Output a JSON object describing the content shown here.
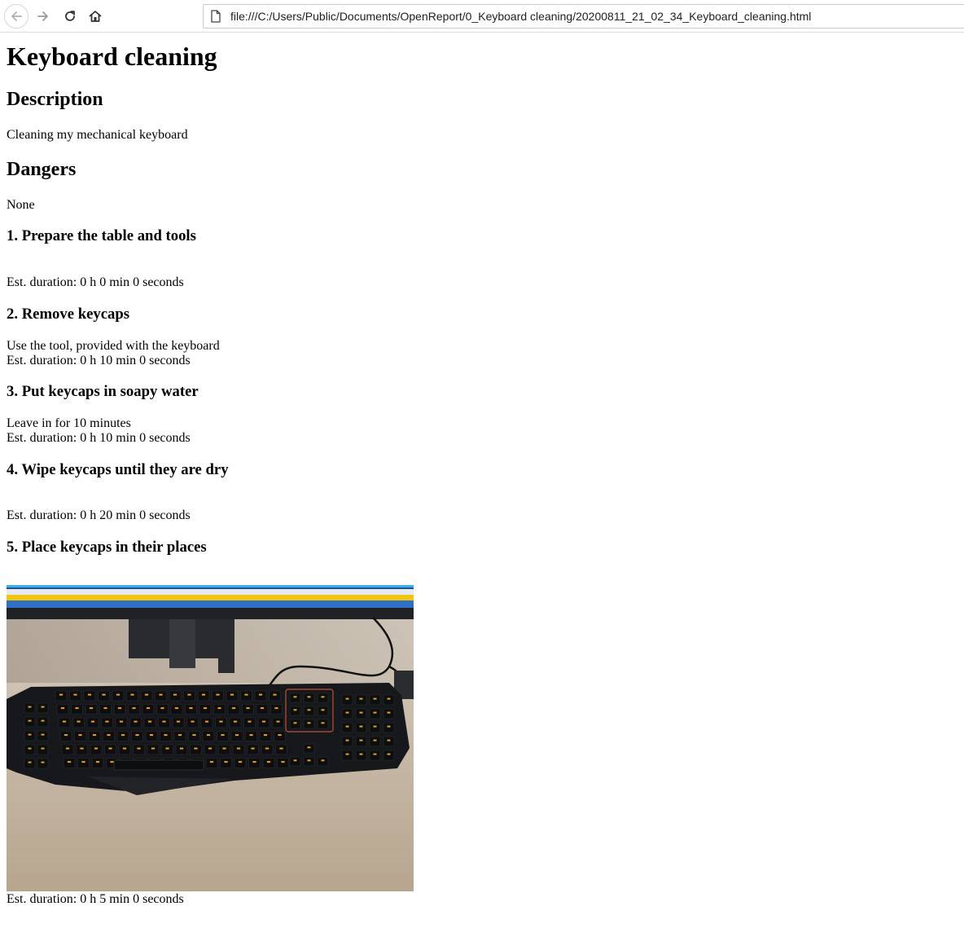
{
  "browser": {
    "url": "file:///C:/Users/Public/Documents/OpenReport/0_Keyboard cleaning/20200811_21_02_34_Keyboard_cleaning.html",
    "icons": [
      "back-arrow-icon",
      "forward-arrow-icon",
      "reload-icon",
      "home-icon",
      "file-icon"
    ]
  },
  "page": {
    "title": "Keyboard cleaning",
    "description_heading": "Description",
    "description": "Cleaning my mechanical keyboard",
    "dangers_heading": "Dangers",
    "dangers": "None"
  },
  "steps": [
    {
      "heading": "1. Prepare the table and tools",
      "note": "",
      "duration": "Est. duration: 0 h 0 min 0 seconds"
    },
    {
      "heading": "2. Remove keycaps",
      "note": "Use the tool, provided with the keyboard",
      "duration": "Est. duration: 0 h 10 min 0 seconds"
    },
    {
      "heading": "3. Put keycaps in soapy water",
      "note": "Leave in for 10 minutes",
      "duration": "Est. duration: 0 h 10 min 0 seconds"
    },
    {
      "heading": "4. Wipe keycaps until they are dry",
      "note": "",
      "duration": "Est. duration: 0 h 20 min 0 seconds"
    },
    {
      "heading": "5. Place keycaps in their places",
      "note": "",
      "duration": "Est. duration: 0 h 5 min 0 seconds"
    }
  ],
  "colors": {
    "key_backlight": "#f0a020",
    "keyboard_body": "#1a1a1c",
    "table": "#cdbfae"
  }
}
